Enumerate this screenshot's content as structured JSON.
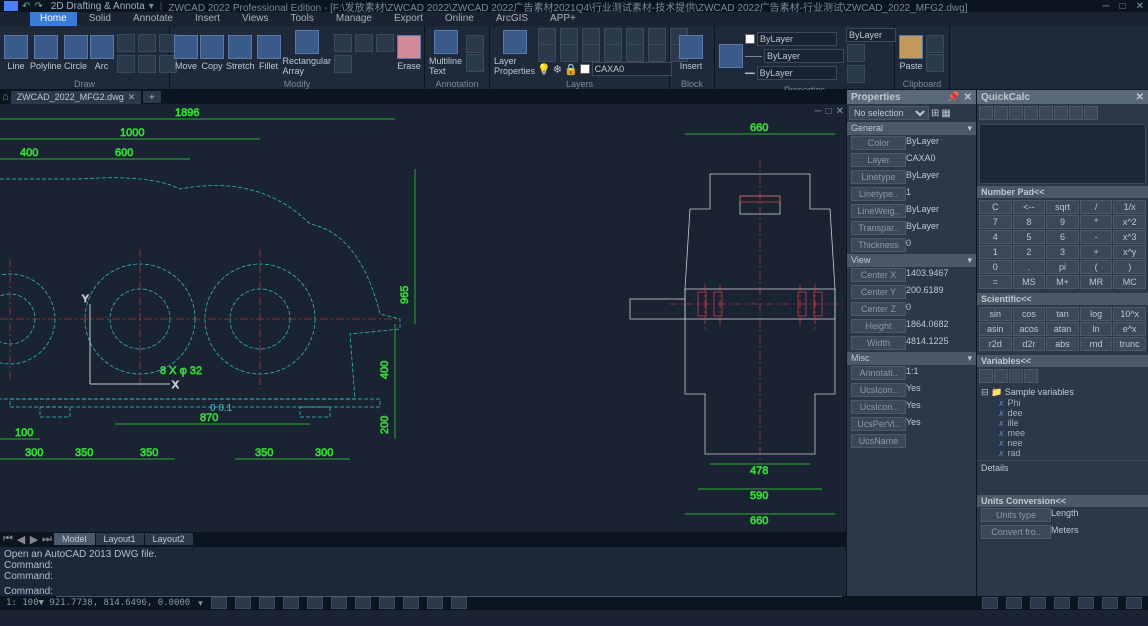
{
  "title": {
    "app": "ZWCAD 2022 Professional Edition",
    "file_path": "[F:\\发放素材\\ZWCAD 2022\\ZWCAD 2022广告素材2021Q4\\行业测试素材-技术提供\\ZWCAD 2022广告素材-行业测试\\ZWCAD_2022_MFG2.dwg]",
    "workspace": "2D Drafting & Annota"
  },
  "menu": [
    "Home",
    "Solid",
    "Annotate",
    "Insert",
    "Views",
    "Tools",
    "Manage",
    "Export",
    "Online",
    "ArcGIS",
    "APP+"
  ],
  "ribbon": {
    "draw": {
      "label": "Draw",
      "items": [
        "Line",
        "Polyline",
        "Circle",
        "Arc"
      ]
    },
    "modify": {
      "label": "Modify",
      "items": [
        "Move",
        "Copy",
        "Stretch",
        "Fillet",
        "Rectangular Array"
      ],
      "erase": "Erase"
    },
    "annotation": {
      "label": "Annotation",
      "item": "Multiline Text"
    },
    "layers": {
      "label": "Layers",
      "item": "Layer Properties",
      "combo_value": "CAXA0",
      "bylayer": "ByLayer"
    },
    "block": {
      "label": "Block",
      "item": "Insert"
    },
    "properties": {
      "label": "Properties",
      "bylayer1": "ByLayer",
      "bylayer2": "ByLayer",
      "bylayer3": "ByLayer"
    },
    "clipboard": {
      "label": "Clipboard",
      "item": "Paste"
    }
  },
  "file_tab": {
    "name": "ZWCAD_2022_MFG2.dwg"
  },
  "drawing": {
    "dims_left": {
      "d1896": "1896",
      "d1000": "1000",
      "d400": "400",
      "d600": "600",
      "d300a": "300",
      "d350a": "350",
      "d100": "100",
      "d350b": "350",
      "d870": "870",
      "d350c": "350",
      "d300b": "300",
      "d965": "965",
      "d400r": "400",
      "d200": "200",
      "d8x32": "8 X φ 32",
      "tol": "0 0.1"
    },
    "dims_right": {
      "d660a": "660",
      "d478": "478",
      "d590": "590",
      "d660b": "660"
    }
  },
  "model_tabs": {
    "model": "Model",
    "l1": "Layout1",
    "l2": "Layout2"
  },
  "cmd": {
    "hist1": "Open an AutoCAD 2013 DWG file.",
    "hist2": "Command:",
    "hist3": "Command:",
    "prompt": "Command:"
  },
  "props": {
    "title": "Properties",
    "selection": "No selection",
    "general": {
      "hdr": "General",
      "rows": [
        [
          "Color",
          "ByLayer"
        ],
        [
          "Layer",
          "CAXA0"
        ],
        [
          "Linetype",
          "ByLayer"
        ],
        [
          "Linetype..",
          "1"
        ],
        [
          "LineWeig..",
          "ByLayer"
        ],
        [
          "Transpar..",
          "ByLayer"
        ],
        [
          "Thickness",
          "0"
        ]
      ]
    },
    "view": {
      "hdr": "View",
      "rows": [
        [
          "Center X",
          "1403.9467"
        ],
        [
          "Center Y",
          "200.6189"
        ],
        [
          "Center Z",
          "0"
        ],
        [
          "Height",
          "1864.0682"
        ],
        [
          "Width",
          "4814.1225"
        ]
      ]
    },
    "misc": {
      "hdr": "Misc",
      "rows": [
        [
          "Annotati..",
          "1:1"
        ],
        [
          "UcsIcon..",
          "Yes"
        ],
        [
          "UcsIcon..",
          "Yes"
        ],
        [
          "UcsPerVi..",
          "Yes"
        ],
        [
          "UcsName",
          ""
        ]
      ]
    }
  },
  "calc": {
    "title": "QuickCalc",
    "numpad": {
      "hdr": "Number Pad<<",
      "keys": [
        "C",
        "<--",
        "sqrt",
        "/",
        "1/x",
        "7",
        "8",
        "9",
        "*",
        "x^2",
        "4",
        "5",
        "6",
        "-",
        "x^3",
        "1",
        "2",
        "3",
        "+",
        "x^y",
        "0",
        ".",
        "pi",
        "(",
        ")",
        "=",
        "MS",
        "M+",
        "MR",
        "MC"
      ]
    },
    "sci": {
      "hdr": "Scientific<<",
      "keys": [
        "sin",
        "cos",
        "tan",
        "log",
        "10^x",
        "asin",
        "acos",
        "atan",
        "ln",
        "e^x",
        "r2d",
        "d2r",
        "abs",
        "rnd",
        "trunc"
      ]
    },
    "vars": {
      "hdr": "Variables<<",
      "root": "Sample variables",
      "items": [
        "Phi",
        "dee",
        "ille",
        "mee",
        "nee",
        "rad"
      ]
    },
    "details": "Details",
    "units": {
      "hdr": "Units Conversion<<",
      "rows": [
        [
          "Units type",
          "Length"
        ],
        [
          "Convert fro..",
          "Meters"
        ]
      ]
    }
  },
  "status": {
    "coords": "1: 100▼ 921.7738, 814.6496, 0.0000"
  }
}
